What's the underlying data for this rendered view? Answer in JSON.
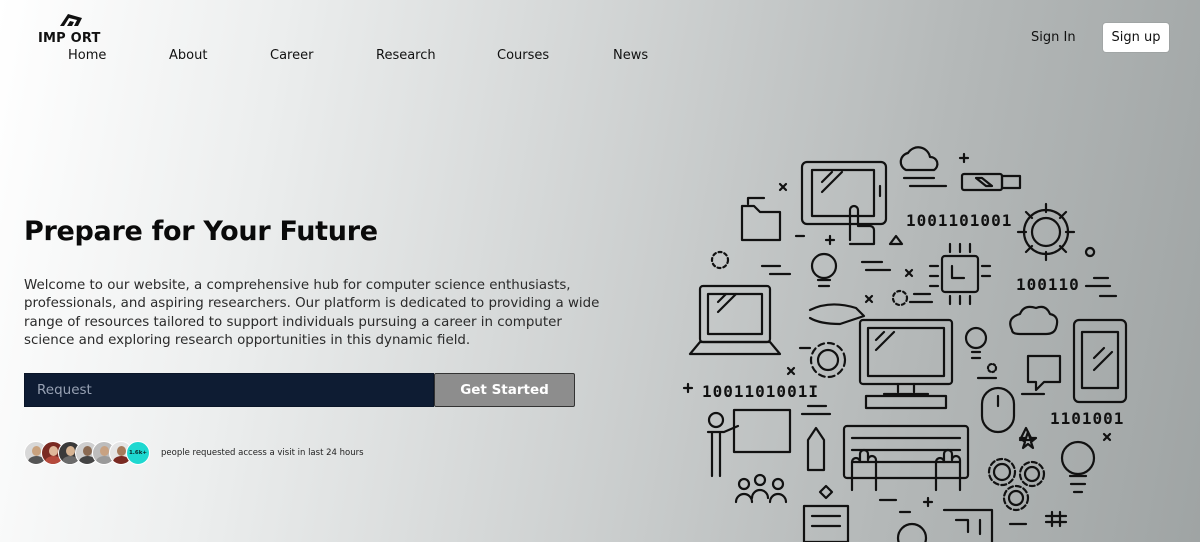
{
  "brand": {
    "name": "IMP ORT"
  },
  "nav": {
    "items": [
      {
        "label": "Home"
      },
      {
        "label": "About"
      },
      {
        "label": "Career"
      },
      {
        "label": "Research"
      },
      {
        "label": "Courses"
      },
      {
        "label": "News"
      }
    ]
  },
  "auth": {
    "sign_in": "Sign In",
    "sign_up": "Sign up"
  },
  "hero": {
    "title": "Prepare for Your Future",
    "description_lines": [
      "Welcome to our website, a comprehensive hub for computer science enthusiasts,",
      "professionals, and aspiring researchers. Our platform is dedicated to providing a wide",
      "range of resources tailored to support individuals pursuing a career in computer",
      "science and exploring research opportunities in this dynamic field."
    ],
    "request_placeholder": "Request",
    "cta_label": "Get Started"
  },
  "social_proof": {
    "badge": "1.6k+",
    "text": "people requested access a visit in last 24 hours",
    "avatar_colors": [
      "#c9a27e",
      "#b54a3c",
      "#6b6b6b",
      "#8a6a52",
      "#9a9a9a",
      "#a67b5b"
    ]
  },
  "illustration": {
    "binary_labels": [
      "1001101001",
      "100110",
      "1001101001I",
      "1101001"
    ]
  }
}
